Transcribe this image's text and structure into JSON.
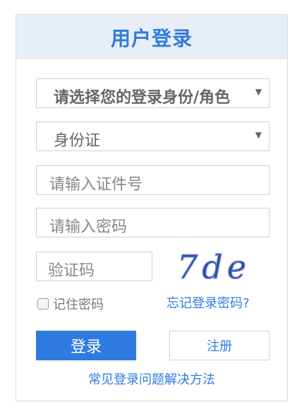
{
  "header": {
    "title": "用户登录"
  },
  "form": {
    "role_select": "请选择您的登录身份/角色",
    "id_type_select": "身份证",
    "id_placeholder": "请输入证件号",
    "password_placeholder": "请输入密码",
    "captcha_placeholder": "验证码",
    "captcha_text": "7de",
    "remember_label": "记住密码",
    "forgot_link": "忘记登录密码?"
  },
  "actions": {
    "login": "登录",
    "register": "注册",
    "faq": "常见登录问题解决方法"
  },
  "colors": {
    "accent": "#2f7be0",
    "header_bg": "#e8eef5"
  }
}
